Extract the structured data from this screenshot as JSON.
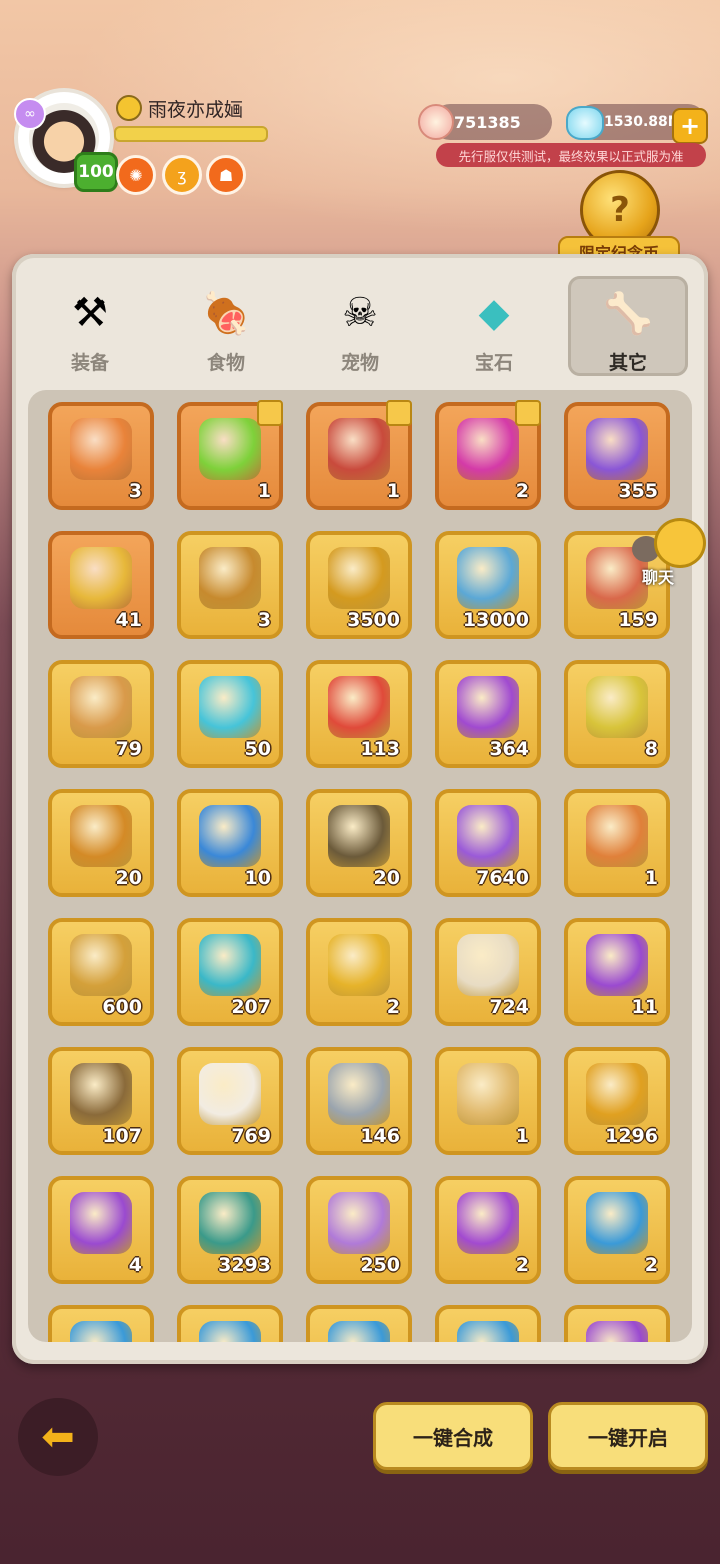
{
  "header": {
    "player_name": "雨夜亦成婳",
    "level": "100",
    "shells": "751385",
    "crystals": "1530.88M",
    "notice": "先行服仅供测试，最终效果以正式服为准",
    "event_label": "限定纪念币",
    "chat_label": "聊天"
  },
  "tabs": [
    {
      "label": "装备",
      "icon": "hammer-icon",
      "active": false
    },
    {
      "label": "食物",
      "icon": "food-bowl-icon",
      "active": false
    },
    {
      "label": "宠物",
      "icon": "dino-skull-icon",
      "active": false
    },
    {
      "label": "宝石",
      "icon": "gem-icon",
      "active": false
    },
    {
      "label": "其它",
      "icon": "bone-icon",
      "active": true
    }
  ],
  "items": [
    {
      "count": "3",
      "style": "orange",
      "icon": "trophy-chest-icon",
      "color": "#e9833a"
    },
    {
      "count": "1",
      "style": "orange",
      "icon": "green-totem-icon",
      "color": "#7ed13a",
      "puzzle": true
    },
    {
      "count": "1",
      "style": "orange",
      "icon": "scroll-icon",
      "color": "#c94a3c",
      "puzzle": true
    },
    {
      "count": "2",
      "style": "orange",
      "icon": "pink-horn-icon",
      "color": "#d43aa8",
      "puzzle": true
    },
    {
      "count": "355",
      "style": "orange",
      "icon": "orb-chest-icon",
      "color": "#8a56d6"
    },
    {
      "count": "41",
      "style": "orange",
      "icon": "trophy-chest-icon",
      "color": "#e7b83a"
    },
    {
      "count": "3",
      "style": "gold",
      "icon": "compass-icon",
      "color": "#c78a2e"
    },
    {
      "count": "3500",
      "style": "gold",
      "icon": "tower-coin-icon",
      "color": "#d49a1f"
    },
    {
      "count": "13000",
      "style": "gold",
      "icon": "mystery-card-icon",
      "color": "#5ba8d6"
    },
    {
      "count": "159",
      "style": "gold",
      "icon": "red-card-icon",
      "color": "#d9684a"
    },
    {
      "count": "79",
      "style": "gold",
      "icon": "rune-card-icon",
      "color": "#d99a4a"
    },
    {
      "count": "50",
      "style": "gold",
      "icon": "ice-rune-icon",
      "color": "#46c4d9"
    },
    {
      "count": "113",
      "style": "gold",
      "icon": "fire-rune-icon",
      "color": "#e04a3a"
    },
    {
      "count": "364",
      "style": "gold",
      "icon": "purple-dust-icon",
      "color": "#a04ad0"
    },
    {
      "count": "8",
      "style": "gold",
      "icon": "trophy-chest-icon",
      "color": "#d8c43a"
    },
    {
      "count": "20",
      "style": "gold",
      "icon": "key-icon",
      "color": "#d48a26"
    },
    {
      "count": "10",
      "style": "gold",
      "icon": "blue-bird-card-icon",
      "color": "#3a88d8"
    },
    {
      "count": "20",
      "style": "gold",
      "icon": "dragon-card-icon",
      "color": "#6b5a3a"
    },
    {
      "count": "7640",
      "style": "gold",
      "icon": "rainbow-gem-icon",
      "color": "#9a5ad8"
    },
    {
      "count": "1",
      "style": "gold",
      "icon": "trophy-chest-icon",
      "color": "#e0803a"
    },
    {
      "count": "600",
      "style": "gold",
      "icon": "gold-vase-icon",
      "color": "#d4a03a"
    },
    {
      "count": "207",
      "style": "gold",
      "icon": "teal-stone-icon",
      "color": "#3ab8c8"
    },
    {
      "count": "2",
      "style": "gold",
      "icon": "gold-ore-icon",
      "color": "#e6b32a"
    },
    {
      "count": "724",
      "style": "gold",
      "icon": "horn-icon",
      "color": "#e8dcc4"
    },
    {
      "count": "11",
      "style": "gold",
      "icon": "purple-bag-icon",
      "color": "#9a4ad0"
    },
    {
      "count": "107",
      "style": "gold",
      "icon": "pickaxe-icon",
      "color": "#8a6a3a"
    },
    {
      "count": "769",
      "style": "gold",
      "icon": "dice-icon",
      "color": "#f2ece2"
    },
    {
      "count": "146",
      "style": "gold",
      "icon": "magnifier-icon",
      "color": "#9aa4ae"
    },
    {
      "count": "1",
      "style": "gold",
      "icon": "swap-card-icon",
      "color": "#e0b86a"
    },
    {
      "count": "1296",
      "style": "gold",
      "icon": "cake-coin-icon",
      "color": "#e0a020"
    },
    {
      "count": "4",
      "style": "gold",
      "icon": "purple-bag-icon",
      "color": "#9a4ad0"
    },
    {
      "count": "3293",
      "style": "gold",
      "icon": "carrot-bag-icon",
      "color": "#3a9a8a"
    },
    {
      "count": "250",
      "style": "gold",
      "icon": "bunny-bag-icon",
      "color": "#b07ad8"
    },
    {
      "count": "2",
      "style": "gold",
      "icon": "purple-bag-icon",
      "color": "#a24ad0"
    },
    {
      "count": "2",
      "style": "gold",
      "icon": "blue-bag-icon",
      "color": "#3a9ad8"
    },
    {
      "count": "",
      "style": "gold",
      "icon": "bag-icon",
      "color": "#3a9ad8"
    },
    {
      "count": "",
      "style": "gold",
      "icon": "bag-icon",
      "color": "#3a9ad8"
    },
    {
      "count": "",
      "style": "gold",
      "icon": "bag-icon",
      "color": "#3a9ad8"
    },
    {
      "count": "",
      "style": "gold",
      "icon": "bag-icon",
      "color": "#3a9ad8"
    },
    {
      "count": "",
      "style": "gold",
      "icon": "bag-icon",
      "color": "#9a4ad0"
    }
  ],
  "buttons": {
    "synthesize": "一键合成",
    "open_all": "一键开启"
  }
}
